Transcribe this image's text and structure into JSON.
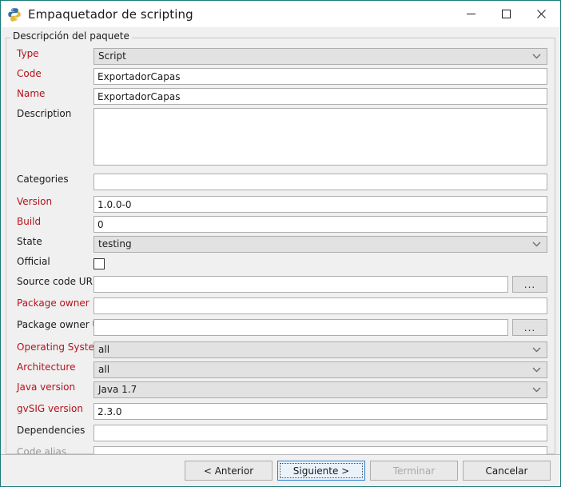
{
  "window": {
    "title": "Empaquetador de scripting",
    "icon": "python-icon",
    "border_color": "#1b7a78",
    "controls": {
      "minimize": "minimize-icon",
      "maximize": "maximize-icon",
      "close": "close-icon"
    }
  },
  "group": {
    "title": "Descripción del paquete"
  },
  "colors": {
    "required_label": "#b5121b",
    "normal_label": "#1b1b1b",
    "disabled_label": "#999999",
    "combo_background": "#e2e2e2",
    "focus_border": "#2a7fd4"
  },
  "fields": {
    "type": {
      "label": "Type",
      "value": "Script",
      "required": true,
      "kind": "combo",
      "disabled": true
    },
    "code": {
      "label": "Code",
      "value": "ExportadorCapas",
      "required": true,
      "kind": "text"
    },
    "name": {
      "label": "Name",
      "value": "ExportadorCapas",
      "required": true,
      "kind": "text"
    },
    "description": {
      "label": "Description",
      "value": "",
      "required": false,
      "kind": "textarea"
    },
    "categories": {
      "label": "Categories",
      "value": "",
      "required": false,
      "kind": "text"
    },
    "version": {
      "label": "Version",
      "value": "1.0.0-0",
      "required": true,
      "kind": "text"
    },
    "build": {
      "label": "Build",
      "value": "0",
      "required": true,
      "kind": "text"
    },
    "state": {
      "label": "State",
      "value": "testing",
      "required": false,
      "kind": "combo",
      "disabled": true
    },
    "official": {
      "label": "Official",
      "value": "",
      "required": false,
      "kind": "checkbox",
      "checked": false
    },
    "source_code_url": {
      "label": "Source code URL",
      "value": "",
      "required": false,
      "kind": "text-browse",
      "browse_label": "..."
    },
    "package_owner": {
      "label": "Package owner",
      "value": "",
      "required": true,
      "kind": "text"
    },
    "package_owner_url": {
      "label": "Package owner URL",
      "value": "",
      "required": false,
      "kind": "text-browse",
      "browse_label": "..."
    },
    "operating_system": {
      "label": "Operating System",
      "value": "all",
      "required": true,
      "kind": "combo",
      "disabled": true
    },
    "architecture": {
      "label": "Architecture",
      "value": "all",
      "required": true,
      "kind": "combo",
      "disabled": true
    },
    "java_version": {
      "label": "Java version",
      "value": "Java 1.7",
      "required": true,
      "kind": "combo",
      "disabled": true
    },
    "gvsig_version": {
      "label": "gvSIG version",
      "value": "2.3.0",
      "required": true,
      "kind": "text"
    },
    "dependencies": {
      "label": "Dependencies",
      "value": "",
      "required": false,
      "kind": "text"
    },
    "code_alias": {
      "label": "Code alias",
      "value": "",
      "required": false,
      "kind": "text",
      "disabled_label": true
    }
  },
  "buttons": {
    "previous": "< Anterior",
    "next": "Siguiente >",
    "finish": "Terminar",
    "cancel": "Cancelar"
  }
}
